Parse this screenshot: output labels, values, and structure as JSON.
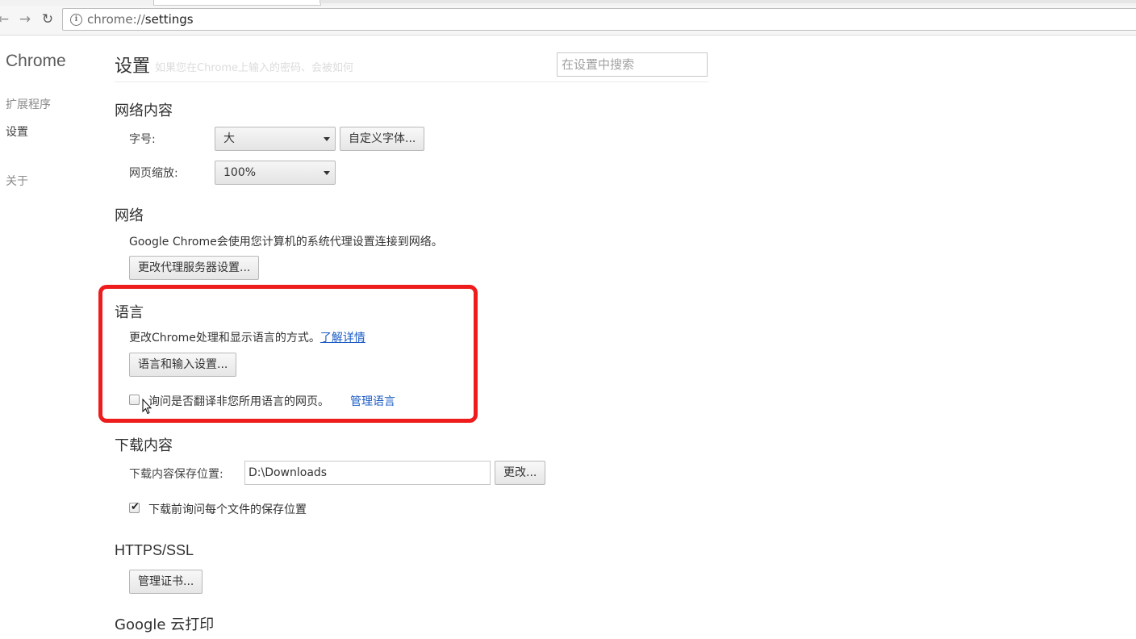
{
  "browser": {
    "url_scheme": "chrome://",
    "url_path": "settings",
    "icons": {
      "back": "arrow-left-icon",
      "forward": "arrow-right-icon",
      "reload": "reload-icon",
      "info": "info-icon"
    }
  },
  "sidebar": {
    "brand": "Chrome",
    "items": [
      {
        "label": "扩展程序"
      },
      {
        "label": "设置",
        "selected": true
      },
      {
        "label": "关于"
      }
    ]
  },
  "header": {
    "title": "设置",
    "ghost_text": "如果您在Chrome上输入的密码、会被如何",
    "search_placeholder": "在设置中搜索"
  },
  "web_content": {
    "title": "网络内容",
    "font_size_label": "字号:",
    "font_size_value": "大",
    "custom_fonts_button": "自定义字体...",
    "zoom_label": "网页缩放:",
    "zoom_value": "100%"
  },
  "network": {
    "title": "网络",
    "description": "Google Chrome会使用您计算机的系统代理设置连接到网络。",
    "proxy_button": "更改代理服务器设置..."
  },
  "languages": {
    "title": "语言",
    "description": "更改Chrome处理和显示语言的方式。",
    "learn_more": "了解详情",
    "settings_button": "语言和输入设置...",
    "translate_checkbox_label": "询问是否翻译非您所用语言的网页。",
    "translate_checked": false,
    "manage_languages": "管理语言",
    "highlight_color": "#ee1c1c"
  },
  "downloads": {
    "title": "下载内容",
    "location_label": "下载内容保存位置:",
    "location_value": "D:\\Downloads",
    "change_button": "更改...",
    "ask_checkbox_label": "下载前询问每个文件的保存位置",
    "ask_checked": true
  },
  "https": {
    "title": "HTTPS/SSL",
    "manage_certs_button": "管理证书..."
  },
  "cloud_print": {
    "title": "Google 云打印"
  },
  "colors": {
    "link": "#1a5bc4",
    "text": "#303030",
    "highlight": "#ee1c1c"
  }
}
